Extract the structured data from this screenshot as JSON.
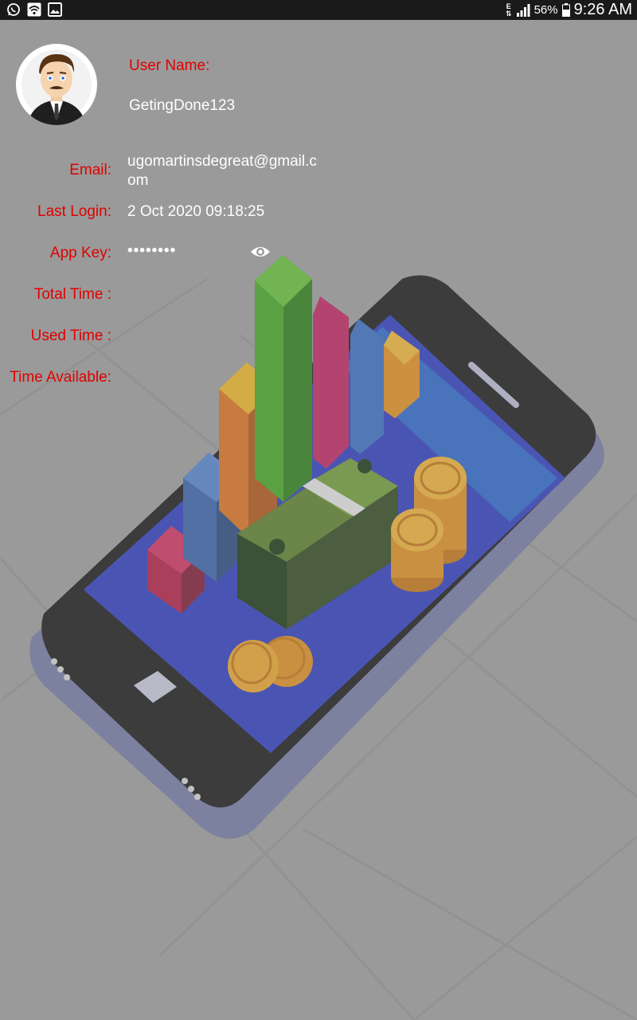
{
  "status_bar": {
    "icons_left": [
      "whatsapp-icon",
      "wifi-icon",
      "image-icon"
    ],
    "network_type": "E",
    "signal_icon": "signal-bars-icon",
    "battery_percent": "56%",
    "battery_icon": "battery-icon",
    "time": "9:26 AM"
  },
  "profile": {
    "avatar_icon": "user-avatar",
    "user_name_label": "User Name:",
    "user_name": "GetingDone123",
    "email_label": "Email:",
    "email": "ugomartinsdegreat@gmail.com",
    "last_login_label": "Last Login:",
    "last_login": "2 Oct 2020 09:18:25",
    "app_key_label": "App Key:",
    "app_key_masked": "••••••••",
    "show_key_icon": "eye-icon",
    "total_time_label": "Total Time :",
    "used_time_label": "Used Time :",
    "time_available_label": "Time Available:"
  },
  "colors": {
    "background": "#9a9a9a",
    "label": "#e00000",
    "value": "#ffffff",
    "status_bar": "#1a1a1a"
  }
}
